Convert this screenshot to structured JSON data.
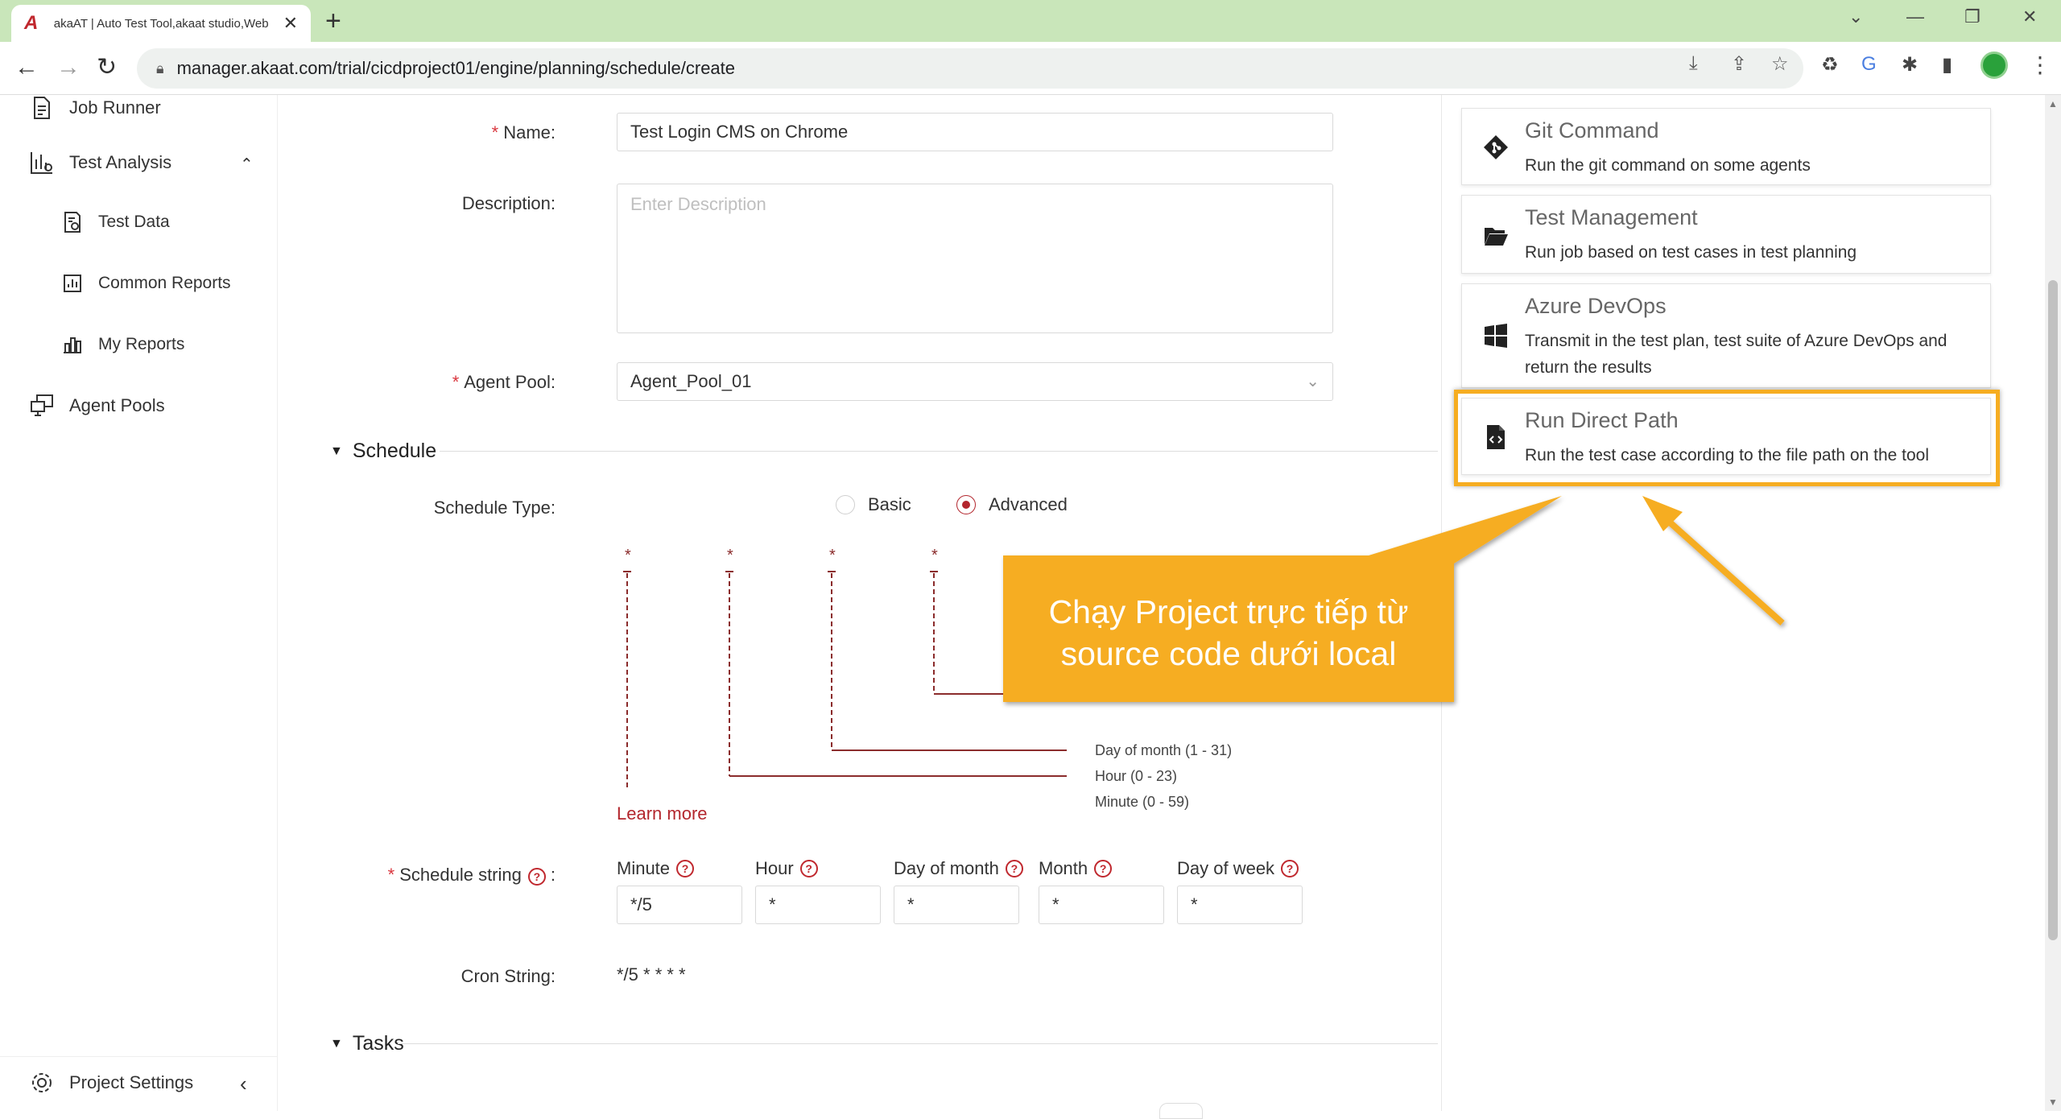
{
  "browser": {
    "tab_title": "akaAT | Auto Test Tool,akaat studio,Web",
    "url": "manager.akaat.com/trial/cicdproject01/engine/planning/schedule/create"
  },
  "sidebar": {
    "job_runner": "Job Runner",
    "test_analysis": "Test Analysis",
    "test_data": "Test Data",
    "common_reports": "Common Reports",
    "my_reports": "My Reports",
    "agent_pools": "Agent Pools",
    "project_settings": "Project Settings"
  },
  "form": {
    "name_label": "Name:",
    "name_value": "Test Login CMS on Chrome",
    "description_label": "Description:",
    "description_placeholder": "Enter Description",
    "agent_pool_label": "Agent Pool:",
    "agent_pool_value": "Agent_Pool_01"
  },
  "schedule": {
    "section_title": "Schedule",
    "type_label": "Schedule Type:",
    "type_options": [
      "Basic",
      "Advanced"
    ],
    "type_selected": "Advanced",
    "cron_stars": [
      "*",
      "*",
      "*",
      "*"
    ],
    "cron_fields": [
      "Day of month (1 - 31)",
      "Hour (0 - 23)",
      "Minute (0 - 59)"
    ],
    "learn_more": "Learn more",
    "string_label": "Schedule string",
    "columns": [
      {
        "label": "Minute",
        "value": "*/5"
      },
      {
        "label": "Hour",
        "value": "*"
      },
      {
        "label": "Day of month",
        "value": "*"
      },
      {
        "label": "Month",
        "value": "*"
      },
      {
        "label": "Day of week",
        "value": "*"
      }
    ],
    "cron_string_label": "Cron String:",
    "cron_string_value": "*/5 * * * *"
  },
  "tasks": {
    "section_title": "Tasks"
  },
  "job_types": [
    {
      "title": "Git Command",
      "desc": "Run the git command on some agents",
      "icon": "git-icon"
    },
    {
      "title": "Test Management",
      "desc": "Run job based on test cases in test planning",
      "icon": "folder-open-icon"
    },
    {
      "title": "Azure DevOps",
      "desc": "Transmit in the test plan, test suite of Azure DevOps and return the results",
      "icon": "windows-icon"
    },
    {
      "title": "Run Direct Path",
      "desc": "Run the test case according to the file path on the tool",
      "icon": "code-file-icon"
    }
  ],
  "callout": {
    "text_line1": "Chạy Project trực tiếp từ",
    "text_line2": "source code dưới local",
    "color": "#f6ad21"
  },
  "colors": {
    "accent": "#b3262d",
    "highlight": "#f6ad21",
    "tabbar": "#c9e6ba"
  }
}
